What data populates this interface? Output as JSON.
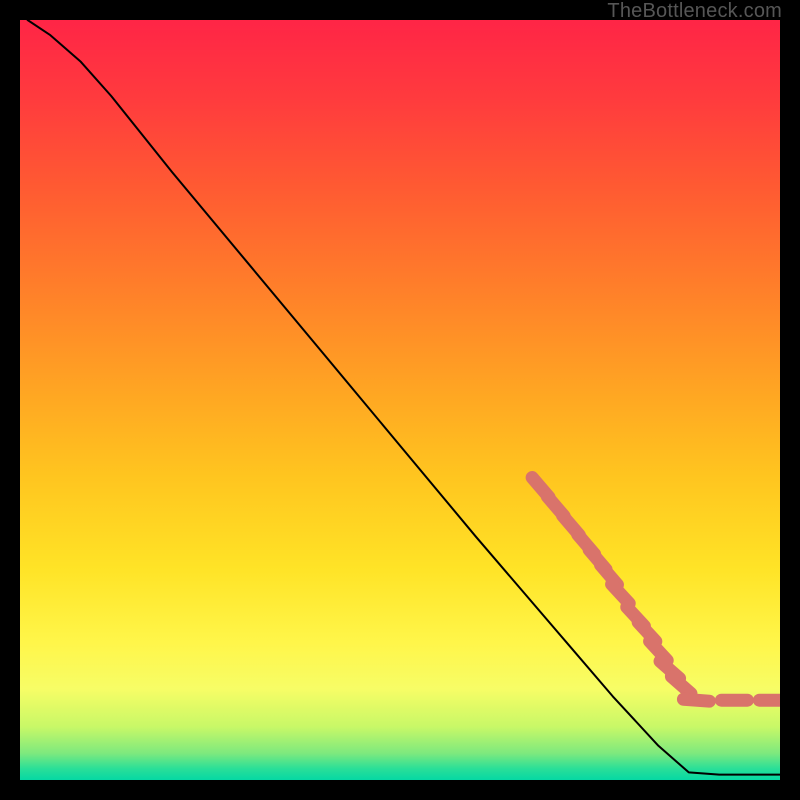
{
  "watermark": "TheBottleneck.com",
  "chart_data": {
    "type": "line",
    "title": "",
    "xlabel": "",
    "ylabel": "",
    "xlim": [
      0,
      100
    ],
    "ylim": [
      0,
      100
    ],
    "curve": {
      "name": "bottleneck-curve",
      "points": [
        {
          "x": 1,
          "y": 100
        },
        {
          "x": 4,
          "y": 98
        },
        {
          "x": 8,
          "y": 94.5
        },
        {
          "x": 12,
          "y": 90
        },
        {
          "x": 20,
          "y": 80
        },
        {
          "x": 30,
          "y": 68
        },
        {
          "x": 40,
          "y": 56
        },
        {
          "x": 50,
          "y": 44
        },
        {
          "x": 60,
          "y": 32
        },
        {
          "x": 66,
          "y": 25
        },
        {
          "x": 72,
          "y": 18
        },
        {
          "x": 78,
          "y": 11
        },
        {
          "x": 84,
          "y": 4.5
        },
        {
          "x": 88,
          "y": 1
        },
        {
          "x": 92,
          "y": 0.7
        },
        {
          "x": 96,
          "y": 0.7
        },
        {
          "x": 100,
          "y": 0.7
        }
      ]
    },
    "markers": {
      "name": "highlight-segment",
      "color": "#d9736b",
      "points": [
        {
          "x": 68.5,
          "y": 38.5
        },
        {
          "x": 70.5,
          "y": 36
        },
        {
          "x": 72.5,
          "y": 33.5
        },
        {
          "x": 74.5,
          "y": 31
        },
        {
          "x": 76,
          "y": 29
        },
        {
          "x": 77.5,
          "y": 27
        },
        {
          "x": 79,
          "y": 24.5
        },
        {
          "x": 81,
          "y": 21.5
        },
        {
          "x": 82.5,
          "y": 19.5
        },
        {
          "x": 84,
          "y": 17
        },
        {
          "x": 85.5,
          "y": 14.5
        },
        {
          "x": 87,
          "y": 12.5
        },
        {
          "x": 89,
          "y": 10.5
        },
        {
          "x": 94,
          "y": 10.5
        },
        {
          "x": 99,
          "y": 10.5
        }
      ]
    },
    "background_gradient": {
      "stops": [
        {
          "offset": 0.0,
          "color": "#ff2546"
        },
        {
          "offset": 0.1,
          "color": "#ff3a3e"
        },
        {
          "offset": 0.22,
          "color": "#ff5a32"
        },
        {
          "offset": 0.35,
          "color": "#ff7e2a"
        },
        {
          "offset": 0.48,
          "color": "#ffa323"
        },
        {
          "offset": 0.6,
          "color": "#ffc51f"
        },
        {
          "offset": 0.72,
          "color": "#ffe326"
        },
        {
          "offset": 0.82,
          "color": "#fff64a"
        },
        {
          "offset": 0.88,
          "color": "#f7fd66"
        },
        {
          "offset": 0.93,
          "color": "#c8f867"
        },
        {
          "offset": 0.965,
          "color": "#7de97e"
        },
        {
          "offset": 0.985,
          "color": "#2adf98"
        },
        {
          "offset": 1.0,
          "color": "#05d8a3"
        }
      ]
    }
  }
}
